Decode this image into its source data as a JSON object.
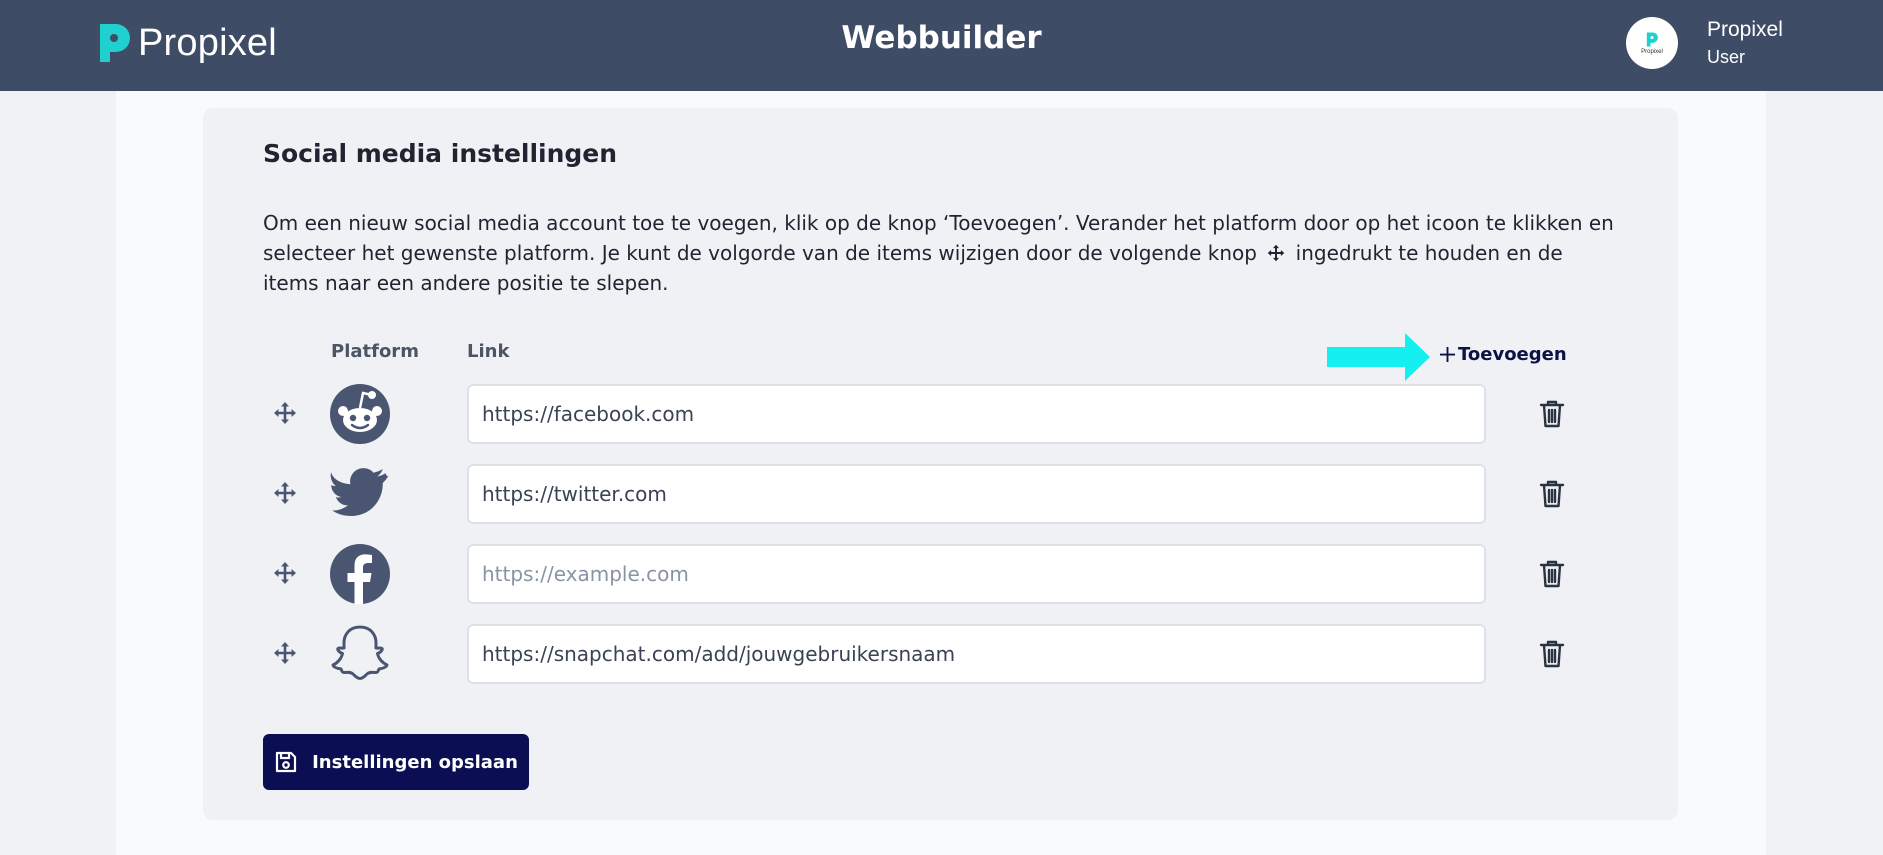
{
  "header": {
    "logo_text": "Propixel",
    "app_title": "Webbuilder",
    "avatar_text": "Propixel",
    "user_name": "Propixel",
    "user_role": "User"
  },
  "settings": {
    "title": "Social media instellingen",
    "description_part1": "Om een nieuw social media account toe te voegen, klik op de knop ‘Toevoegen’. Verander het platform door op het icoon te klikken en selecteer het gewenste platform. Je kunt de volgorde van de items wijzigen door de volgende knop",
    "description_part2": "ingedrukt te houden en de items naar een andere positie te slepen.",
    "column_platform": "Platform",
    "column_link": "Link",
    "add_label": "Toevoegen",
    "save_label": "Instellingen opslaan"
  },
  "rows": [
    {
      "platform_icon": "reddit-icon",
      "value": "https://facebook.com",
      "placeholder": ""
    },
    {
      "platform_icon": "twitter-icon",
      "value": "https://twitter.com",
      "placeholder": ""
    },
    {
      "platform_icon": "facebook-icon",
      "value": "",
      "placeholder": "https://example.com"
    },
    {
      "platform_icon": "snapchat-icon",
      "value": "https://snapchat.com/add/jouwgebruikersnaam",
      "placeholder": ""
    }
  ],
  "colors": {
    "header_bg": "#3e4c66",
    "brand_teal": "#1fd0cf",
    "arrow_cyan": "#14f0f0",
    "save_button_bg": "#0b0e52",
    "icon_slate": "#4a5671"
  }
}
